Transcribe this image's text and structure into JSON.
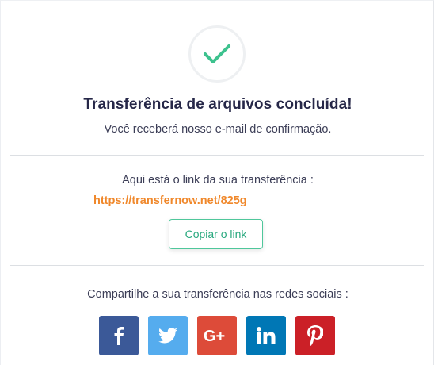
{
  "title": "Transferência de arquivos concluída!",
  "subtitle": "Você receberá nosso e-mail de confirmação.",
  "link_section": {
    "label": "Aqui está o link da sua transferência :",
    "url": "https://transfernow.net/825g",
    "copy_button": "Copiar o link"
  },
  "share_section": {
    "label": "Compartilhe a sua transferência nas redes sociais :",
    "networks": [
      {
        "icon": "facebook-icon",
        "color": "#3b5998"
      },
      {
        "icon": "twitter-icon",
        "color": "#55acee"
      },
      {
        "icon": "google-plus-icon",
        "color": "#dd4b39"
      },
      {
        "icon": "linkedin-icon",
        "color": "#0077b5"
      },
      {
        "icon": "pinterest-icon",
        "color": "#cb2027"
      }
    ]
  },
  "colors": {
    "success": "#3dc28e",
    "link": "#f0882b",
    "button_border": "#4fc79b"
  }
}
